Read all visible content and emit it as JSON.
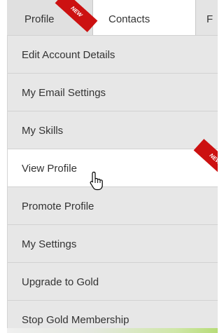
{
  "tabs": [
    {
      "label": "Profile"
    },
    {
      "label": "Contacts"
    },
    {
      "label": "F"
    }
  ],
  "badges": {
    "tab_new": "NEW",
    "menu_new": "NEW"
  },
  "menu": {
    "items": [
      {
        "label": "Edit Account Details"
      },
      {
        "label": "My Email Settings"
      },
      {
        "label": "My Skills"
      },
      {
        "label": "View Profile"
      },
      {
        "label": "Promote Profile"
      },
      {
        "label": "My Settings"
      },
      {
        "label": "Upgrade to Gold"
      },
      {
        "label": "Stop Gold Membership"
      }
    ]
  },
  "icons": {
    "cursor": "hand-pointer-cursor"
  },
  "colors": {
    "ribbon": "#cc1111",
    "menu_bg": "#e7e7e7",
    "menu_active_bg": "#ffffff",
    "text": "#333333"
  }
}
